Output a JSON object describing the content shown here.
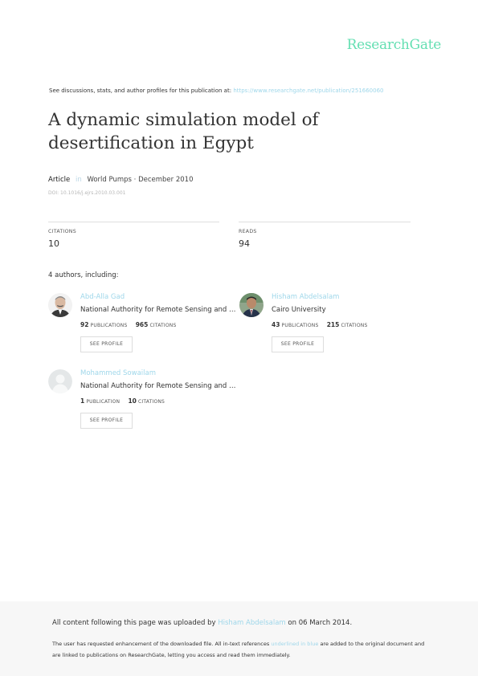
{
  "header": {
    "brand": "ResearchGate",
    "discussions_text": "See discussions, stats, and author profiles for this publication at:",
    "publication_url": "https://www.researchgate.net/publication/251660060"
  },
  "publication": {
    "title": "A dynamic simulation model of desertification in Egypt",
    "type": "Article",
    "in_word": "in",
    "journal": "World Pumps",
    "date_sep": "·",
    "date": "December 2010",
    "doi": "DOI: 10.1016/j.ejrs.2010.03.001"
  },
  "stats": {
    "citations_label": "CITATIONS",
    "citations_value": "10",
    "reads_label": "READS",
    "reads_value": "94"
  },
  "authors_heading": "4 authors, including:",
  "authors": [
    {
      "name": "Abd-Alla Gad",
      "affiliation": "National Authority for Remote Sensing and S…",
      "publications": "92",
      "publications_label": "PUBLICATIONS",
      "citations": "965",
      "citations_label": "CITATIONS",
      "button": "SEE PROFILE"
    },
    {
      "name": "Hisham Abdelsalam",
      "affiliation": "Cairo University",
      "publications": "43",
      "publications_label": "PUBLICATIONS",
      "citations": "215",
      "citations_label": "CITATIONS",
      "button": "SEE PROFILE"
    },
    {
      "name": "Mohammed Sowailam",
      "affiliation": "National Authority for Remote Sensing and S…",
      "publications": "1",
      "publications_label": "PUBLICATION",
      "citations": "10",
      "citations_label": "CITATIONS",
      "button": "SEE PROFILE"
    }
  ],
  "footer": {
    "upload_prefix": "All content following this page was uploaded by",
    "uploader": "Hisham Abdelsalam",
    "upload_suffix": "on 06 March 2014.",
    "notice_prefix": "The user has requested enhancement of the downloaded file. All in-text references",
    "notice_link": "underlined in blue",
    "notice_suffix": "are added to the original document and are linked to publications on ResearchGate, letting you access and read them immediately."
  },
  "colors": {
    "brand": "#64dfb2",
    "link": "#9fd7ea",
    "footer_bg": "#f7f7f7"
  }
}
